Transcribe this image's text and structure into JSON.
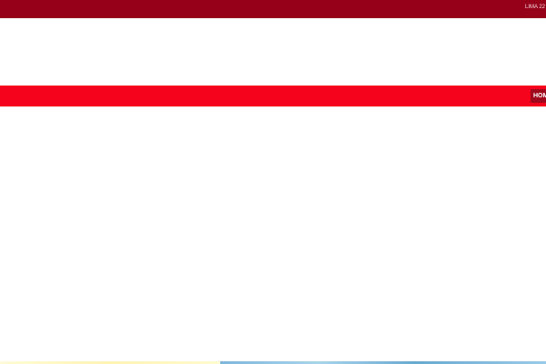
{
  "topbar": {
    "location_text": "LIMA 22"
  },
  "navbar": {
    "items": [
      {
        "label": "HOM"
      }
    ]
  },
  "colors": {
    "topbar_bg": "#960019",
    "navbar_bg": "#f5021c",
    "nav_active_bg": "#a00a1c"
  }
}
